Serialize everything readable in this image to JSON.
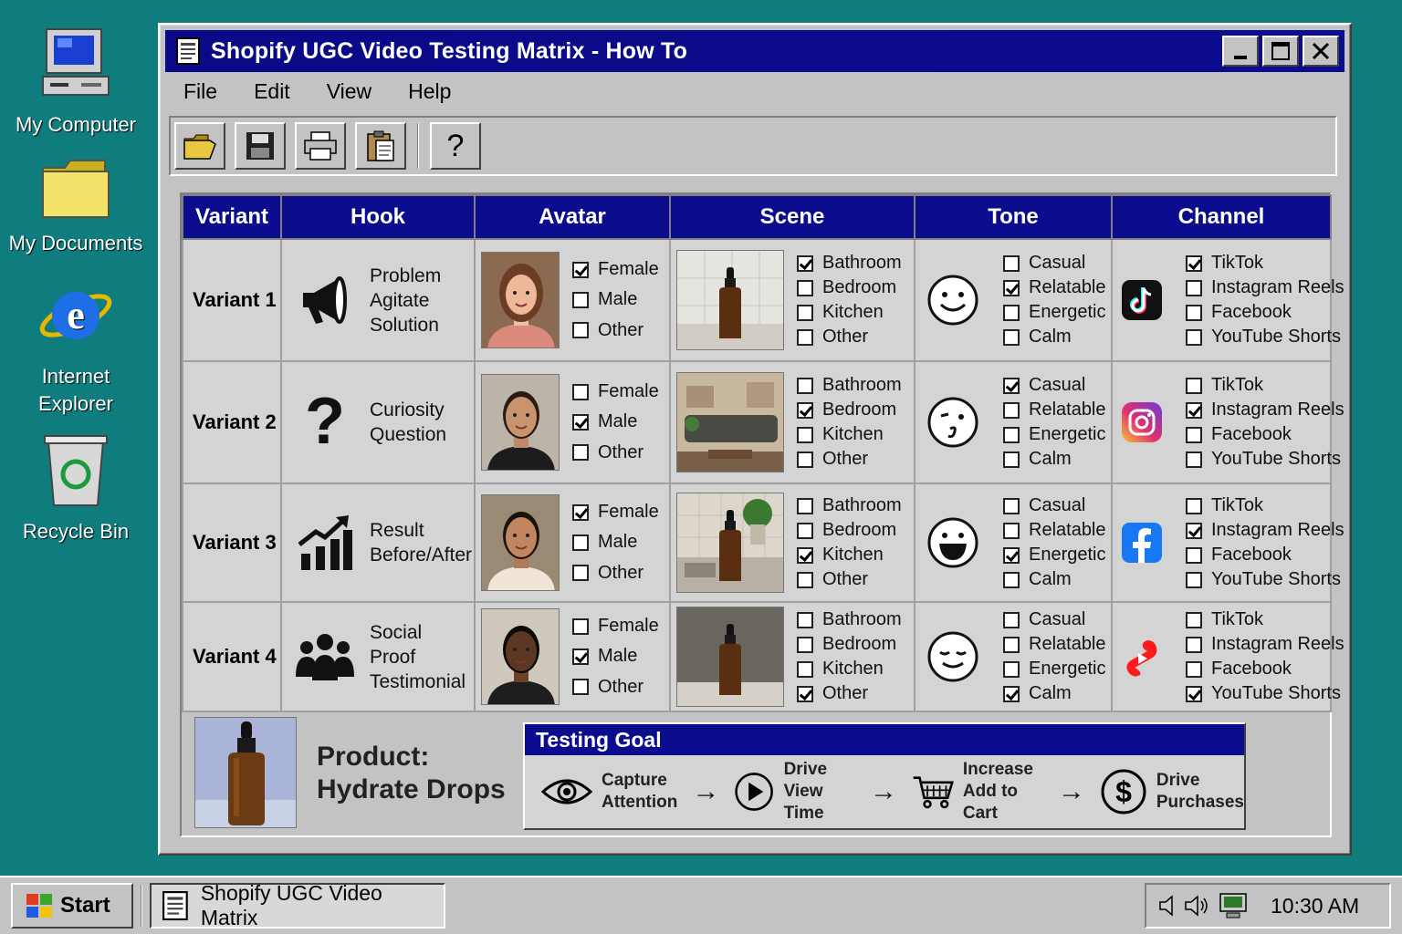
{
  "desktop": {
    "icons": [
      {
        "label": "My Computer",
        "icon": "computer-icon"
      },
      {
        "label": "My Documents",
        "icon": "folder-icon"
      },
      {
        "label": "Internet Explorer",
        "icon": "ie-icon"
      },
      {
        "label": "Recycle Bin",
        "icon": "recycle-bin-icon"
      }
    ]
  },
  "window": {
    "title": "Shopify UGC Video Testing Matrix - How To",
    "controls": {
      "minimize": "_",
      "maximize": "□",
      "close": "✕"
    }
  },
  "menu": [
    "File",
    "Edit",
    "View",
    "Help"
  ],
  "toolbar": {
    "icons": [
      "open-folder-icon",
      "save-icon",
      "print-icon",
      "clipboard-icon",
      "help-icon"
    ],
    "help_label": "?"
  },
  "table": {
    "headers": [
      "Variant",
      "Hook",
      "Avatar",
      "Scene",
      "Tone",
      "Channel"
    ],
    "rows": [
      {
        "variant": "Variant 1",
        "hook": "Problem Agitate Solution",
        "hook_icon": "megaphone-icon",
        "avatar": {
          "options": [
            "Female",
            "Male",
            "Other"
          ],
          "checked": 0
        },
        "scene": {
          "options": [
            "Bathroom",
            "Bedroom",
            "Kitchen",
            "Other"
          ],
          "checked": 0
        },
        "tone": {
          "face": "smile-face-icon",
          "options": [
            "Casual",
            "Relatable",
            "Energetic",
            "Calm"
          ],
          "checked": 1
        },
        "channel": {
          "icon": "tiktok-icon",
          "options": [
            "TikTok",
            "Instagram Reels",
            "Facebook",
            "YouTube Shorts"
          ],
          "checked": 0
        }
      },
      {
        "variant": "Variant 2",
        "hook": "Curiosity Question",
        "hook_icon": "question-mark-icon",
        "avatar": {
          "options": [
            "Female",
            "Male",
            "Other"
          ],
          "checked": 1
        },
        "scene": {
          "options": [
            "Bathroom",
            "Bedroom",
            "Kitchen",
            "Other"
          ],
          "checked": 1
        },
        "tone": {
          "face": "wink-face-icon",
          "options": [
            "Casual",
            "Relatable",
            "Energetic",
            "Calm"
          ],
          "checked": 0
        },
        "channel": {
          "icon": "instagram-icon",
          "options": [
            "TikTok",
            "Instagram Reels",
            "Facebook",
            "YouTube Shorts"
          ],
          "checked": 1
        }
      },
      {
        "variant": "Variant 3",
        "hook": "Result Before/After",
        "hook_icon": "growth-chart-icon",
        "avatar": {
          "options": [
            "Female",
            "Male",
            "Other"
          ],
          "checked": 0
        },
        "scene": {
          "options": [
            "Bathroom",
            "Bedroom",
            "Kitchen",
            "Other"
          ],
          "checked": 2
        },
        "tone": {
          "face": "laugh-face-icon",
          "options": [
            "Casual",
            "Relatable",
            "Energetic",
            "Calm"
          ],
          "checked": 2
        },
        "channel": {
          "icon": "facebook-icon",
          "options": [
            "TikTok",
            "Instagram Reels",
            "Facebook",
            "YouTube Shorts"
          ],
          "checked": 1
        }
      },
      {
        "variant": "Variant 4",
        "hook": "Social Proof Testimonial",
        "hook_icon": "group-icon",
        "avatar": {
          "options": [
            "Female",
            "Male",
            "Other"
          ],
          "checked": 1
        },
        "scene": {
          "options": [
            "Bathroom",
            "Bedroom",
            "Kitchen",
            "Other"
          ],
          "checked": 3
        },
        "tone": {
          "face": "calm-face-icon",
          "options": [
            "Casual",
            "Relatable",
            "Energetic",
            "Calm"
          ],
          "checked": 3
        },
        "channel": {
          "icon": "youtube-shorts-icon",
          "options": [
            "TikTok",
            "Instagram Reels",
            "Facebook",
            "YouTube Shorts"
          ],
          "checked": 3
        }
      }
    ]
  },
  "product": {
    "label": "Product:",
    "name": "Hydrate Drops"
  },
  "goal": {
    "title": "Testing Goal",
    "steps": [
      {
        "icon": "eye-icon",
        "l1": "Capture",
        "l2": "Attention"
      },
      {
        "icon": "play-icon",
        "l1": "Drive",
        "l2": "View Time"
      },
      {
        "icon": "cart-icon",
        "l1": "Increase",
        "l2": "Add to Cart"
      },
      {
        "icon": "dollar-icon",
        "l1": "Drive",
        "l2": "Purchases"
      }
    ],
    "arrow": "→"
  },
  "taskbar": {
    "start": "Start",
    "item": "Shopify UGC Video Matrix",
    "clock": "10:30 AM"
  },
  "colors": {
    "desktop": "#0f7d7e",
    "titlebar": "#0c0c8e",
    "chrome": "#c3c3c3"
  }
}
